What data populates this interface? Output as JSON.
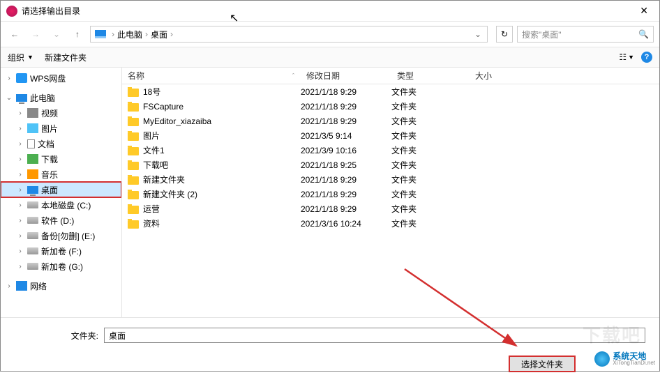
{
  "window": {
    "title": "请选择输出目录"
  },
  "nav": {
    "breadcrumb": [
      "此电脑",
      "桌面"
    ],
    "search_placeholder": "搜索\"桌面\""
  },
  "toolbar": {
    "organize": "组织",
    "new_folder": "新建文件夹"
  },
  "tree": {
    "items": [
      {
        "label": "WPS网盘",
        "level": 0,
        "exp": "›",
        "icon": "wps"
      },
      {
        "label": "此电脑",
        "level": 0,
        "exp": "⌄",
        "icon": "monitor"
      },
      {
        "label": "视频",
        "level": 1,
        "exp": "›",
        "icon": "video"
      },
      {
        "label": "图片",
        "level": 1,
        "exp": "›",
        "icon": "pic"
      },
      {
        "label": "文档",
        "level": 1,
        "exp": "›",
        "icon": "doc"
      },
      {
        "label": "下载",
        "level": 1,
        "exp": "›",
        "icon": "down"
      },
      {
        "label": "音乐",
        "level": 1,
        "exp": "›",
        "icon": "music"
      },
      {
        "label": "桌面",
        "level": 1,
        "exp": "›",
        "icon": "monitor",
        "sel": true,
        "hl": true
      },
      {
        "label": "本地磁盘 (C:)",
        "level": 1,
        "exp": "›",
        "icon": "drive"
      },
      {
        "label": "软件 (D:)",
        "level": 1,
        "exp": "›",
        "icon": "drive"
      },
      {
        "label": "备份[勿删] (E:)",
        "level": 1,
        "exp": "›",
        "icon": "drive"
      },
      {
        "label": "新加卷 (F:)",
        "level": 1,
        "exp": "›",
        "icon": "drive"
      },
      {
        "label": "新加卷 (G:)",
        "level": 1,
        "exp": "›",
        "icon": "drive"
      },
      {
        "label": "网络",
        "level": 0,
        "exp": "›",
        "icon": "net"
      }
    ]
  },
  "columns": {
    "name": "名称",
    "date": "修改日期",
    "type": "类型",
    "size": "大小"
  },
  "files": [
    {
      "name": "18号",
      "date": "2021/1/18 9:29",
      "type": "文件夹"
    },
    {
      "name": "FSCapture",
      "date": "2021/1/18 9:29",
      "type": "文件夹"
    },
    {
      "name": "MyEditor_xiazaiba",
      "date": "2021/1/18 9:29",
      "type": "文件夹"
    },
    {
      "name": "图片",
      "date": "2021/3/5 9:14",
      "type": "文件夹"
    },
    {
      "name": "文件1",
      "date": "2021/3/9 10:16",
      "type": "文件夹"
    },
    {
      "name": "下载吧",
      "date": "2021/1/18 9:25",
      "type": "文件夹"
    },
    {
      "name": "新建文件夹",
      "date": "2021/1/18 9:29",
      "type": "文件夹"
    },
    {
      "name": "新建文件夹 (2)",
      "date": "2021/1/18 9:29",
      "type": "文件夹"
    },
    {
      "name": "运营",
      "date": "2021/1/18 9:29",
      "type": "文件夹"
    },
    {
      "name": "资料",
      "date": "2021/3/16 10:24",
      "type": "文件夹"
    }
  ],
  "footer": {
    "folder_label": "文件夹:",
    "folder_value": "桌面",
    "select_button": "选择文件夹"
  },
  "watermark": {
    "cn": "系统天地",
    "en": "XiTongTianDi.net",
    "faded": "下载吧"
  }
}
